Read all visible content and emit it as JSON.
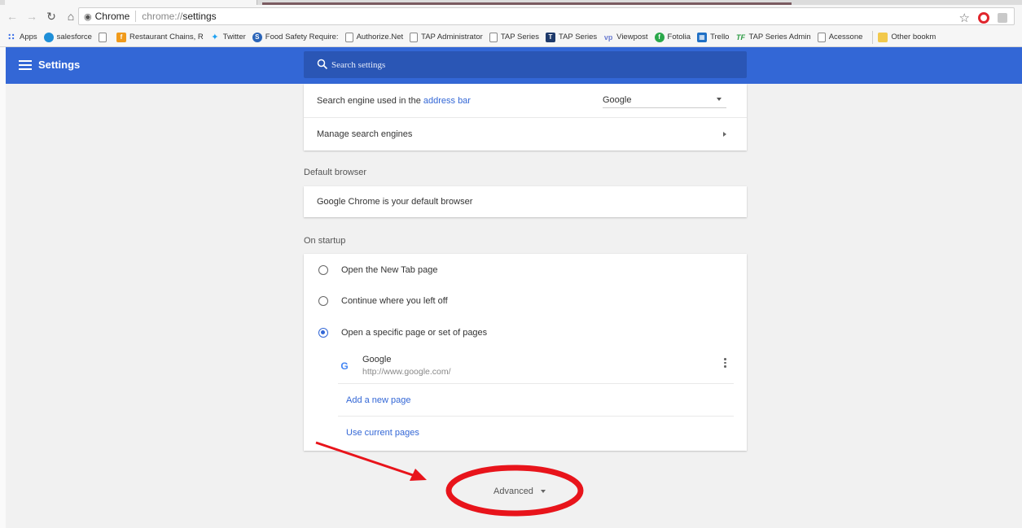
{
  "browser": {
    "site_label": "Chrome",
    "url_scheme": "chrome://",
    "url_path": "settings"
  },
  "bookmarks": [
    {
      "label": "Apps",
      "icon": "apps-icon"
    },
    {
      "label": "salesforce",
      "icon": "salesforce-icon"
    },
    {
      "label": "",
      "icon": "page-icon"
    },
    {
      "label": "Restaurant Chains, R",
      "icon": "facebook-icon"
    },
    {
      "label": "Twitter",
      "icon": "twitter-icon"
    },
    {
      "label": "Food Safety Require:",
      "icon": "food-safety-icon"
    },
    {
      "label": "Authorize.Net",
      "icon": "page-icon"
    },
    {
      "label": "TAP Administrator",
      "icon": "page-icon"
    },
    {
      "label": "TAP Series",
      "icon": "page-icon"
    },
    {
      "label": "TAP Series",
      "icon": "tap-icon"
    },
    {
      "label": "Viewpost",
      "icon": "viewpost-icon"
    },
    {
      "label": "Fotolia",
      "icon": "fotolia-icon"
    },
    {
      "label": "Trello",
      "icon": "trello-icon"
    },
    {
      "label": "TAP Series Admin",
      "icon": "tap-series-admin-icon"
    },
    {
      "label": "Acessone",
      "icon": "page-icon"
    }
  ],
  "other_bookmarks": "Other bookm",
  "header": {
    "title": "Settings",
    "search_placeholder": "Search settings"
  },
  "search_engine": {
    "label_prefix": "Search engine used in the ",
    "label_link": "address bar",
    "selected": "Google",
    "manage_label": "Manage search engines"
  },
  "default_browser": {
    "section_title": "Default browser",
    "status": "Google Chrome is your default browser"
  },
  "on_startup": {
    "section_title": "On startup",
    "options": [
      {
        "label": "Open the New Tab page",
        "checked": false
      },
      {
        "label": "Continue where you left off",
        "checked": false
      },
      {
        "label": "Open a specific page or set of pages",
        "checked": true
      }
    ],
    "page": {
      "name": "Google",
      "url": "http://www.google.com/"
    },
    "add_page": "Add a new page",
    "use_current": "Use current pages"
  },
  "advanced_label": "Advanced",
  "colors": {
    "header_blue": "#3367d6",
    "search_box": "#2a56b5",
    "link": "#3367d6",
    "annotation_red": "#e8141b"
  }
}
